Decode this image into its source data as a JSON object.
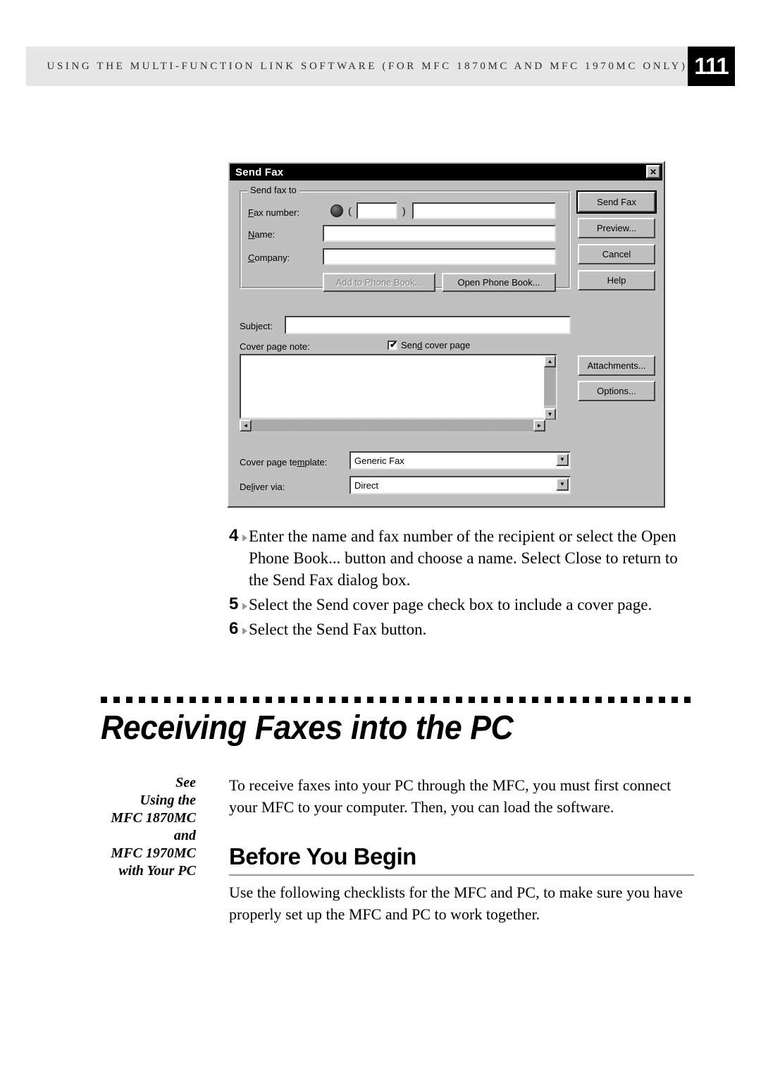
{
  "header": {
    "running_head": "USING THE MULTI-FUNCTION LINK SOFTWARE (FOR MFC 1870MC AND MFC 1970MC ONLY)",
    "page_number": "111"
  },
  "dialog": {
    "title": "Send Fax",
    "close_label": "✕",
    "group": {
      "legend": "Send fax to",
      "fax_number_label": "Fax number:",
      "name_label": "Name:",
      "company_label": "Company:",
      "fax_area_code_value": "",
      "fax_number_value": "",
      "name_value": "",
      "company_value": "",
      "paren_open": "(",
      "paren_close": ")",
      "add_phone_book_label": "Add to Phone Book...",
      "open_phone_book_label": "Open Phone Book..."
    },
    "subject_label": "Subject:",
    "subject_value": "",
    "cover_page_note_label": "Cover page note:",
    "send_cover_page_label": "Send cover page",
    "send_cover_page_checked": "✔",
    "cover_page_note_value": "",
    "cover_page_template_label": "Cover page template:",
    "cover_page_template_value": "Generic Fax",
    "deliver_via_label": "Deliver via:",
    "deliver_via_value": "Direct",
    "buttons": {
      "send_fax": "Send Fax",
      "preview": "Preview...",
      "cancel": "Cancel",
      "help": "Help",
      "attachments": "Attachments...",
      "options": "Options..."
    },
    "scroll": {
      "up_arrow": "▲",
      "down_arrow": "▼",
      "left_arrow": "◄",
      "right_arrow": "►"
    },
    "combo_arrow": "▼"
  },
  "steps": [
    {
      "number": "4",
      "text": "Enter the name and fax number of the recipient or select the Open Phone Book... button and choose a name.  Select Close to return to the Send Fax dialog box."
    },
    {
      "number": "5",
      "text": "Select the Send cover page check box to include a cover page."
    },
    {
      "number": "6",
      "text": "Select the Send Fax button."
    }
  ],
  "chapter": {
    "title": "Receiving Faxes into the PC"
  },
  "margin_note": {
    "lines": "See\nUsing the\nMFC 1870MC\nand\nMFC 1970MC\nwith Your PC"
  },
  "body": {
    "intro": "To receive faxes into your PC through the MFC, you must first connect your MFC to your computer. Then, you can load the software.",
    "section_heading": "Before You Begin",
    "section_paragraph": "Use the following checklists for the MFC and PC, to make sure you have properly set up the MFC and PC to work together."
  }
}
